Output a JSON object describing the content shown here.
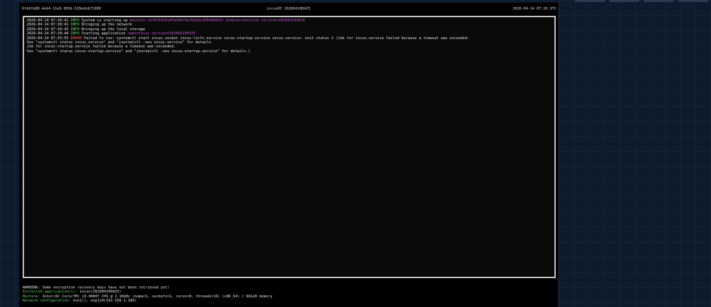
{
  "header": {
    "left": "6fe6fe80-4eb4-11e9-965b-529edeb71980",
    "center": "incus03 202604100425",
    "right": "2026-04-14 07:26 UTC"
  },
  "log": [
    {
      "ts": "2026-04-14 07:10:41",
      "level": "INFO",
      "text": "System is starting up",
      "kv": "machine-id=07d435a45dd94f9ed5a61e308d48641c mode=production version=202604100425"
    },
    {
      "ts": "2026-04-14 07:10:41",
      "level": "INFO",
      "text": "Bringing up the network",
      "kv": ""
    },
    {
      "ts": "2026-04-14 07:10:43",
      "level": "INFO",
      "text": "Bringing up the local storage",
      "kv": ""
    },
    {
      "ts": "2026-04-14 07:10:44",
      "level": "INFO",
      "text": "Starting application",
      "kv": "name=incus version=202604100425"
    },
    {
      "ts": "2026-04-14 07:25:55",
      "level": "ERROR",
      "text": "Failed to run: systemctl start incus.socket incus-lxcfs.service incus-startup.service incus.service: exit status 1 (Job for incus.service failed because a timeout was exceeded.",
      "kv": ""
    }
  ],
  "log_cont": [
    "See \"systemctl status incus.service\" and \"journalctl -xeu incus.service\" for details.",
    "Job for incus-startup.service failed because a timeout was exceeded.",
    "See \"systemctl status incus-startup.service\" and \"journalctl -xeu incus-startup.service\" for details.)"
  ],
  "footer": {
    "warning": "WARNING: Some encryption recovery keys have not been retrieved yet!",
    "apps_label": "Installed application(s):",
    "apps_value": "incus(202604100425)",
    "machine_label": "Machine:",
    "machine_value": "Intel(R) Core(TM) i9-9900T CPU @ 2.10GHz (numa=1, sockets=1, cores=8, threads=16) (x86_64) / 66GiB memory",
    "network_label": "Network configuration:",
    "network_value": "eno1(), enp1s0(192.168.1.186)"
  },
  "colors": {
    "info": "#6ad36a",
    "error": "#ff5a5a",
    "kv": "#c050d0"
  }
}
